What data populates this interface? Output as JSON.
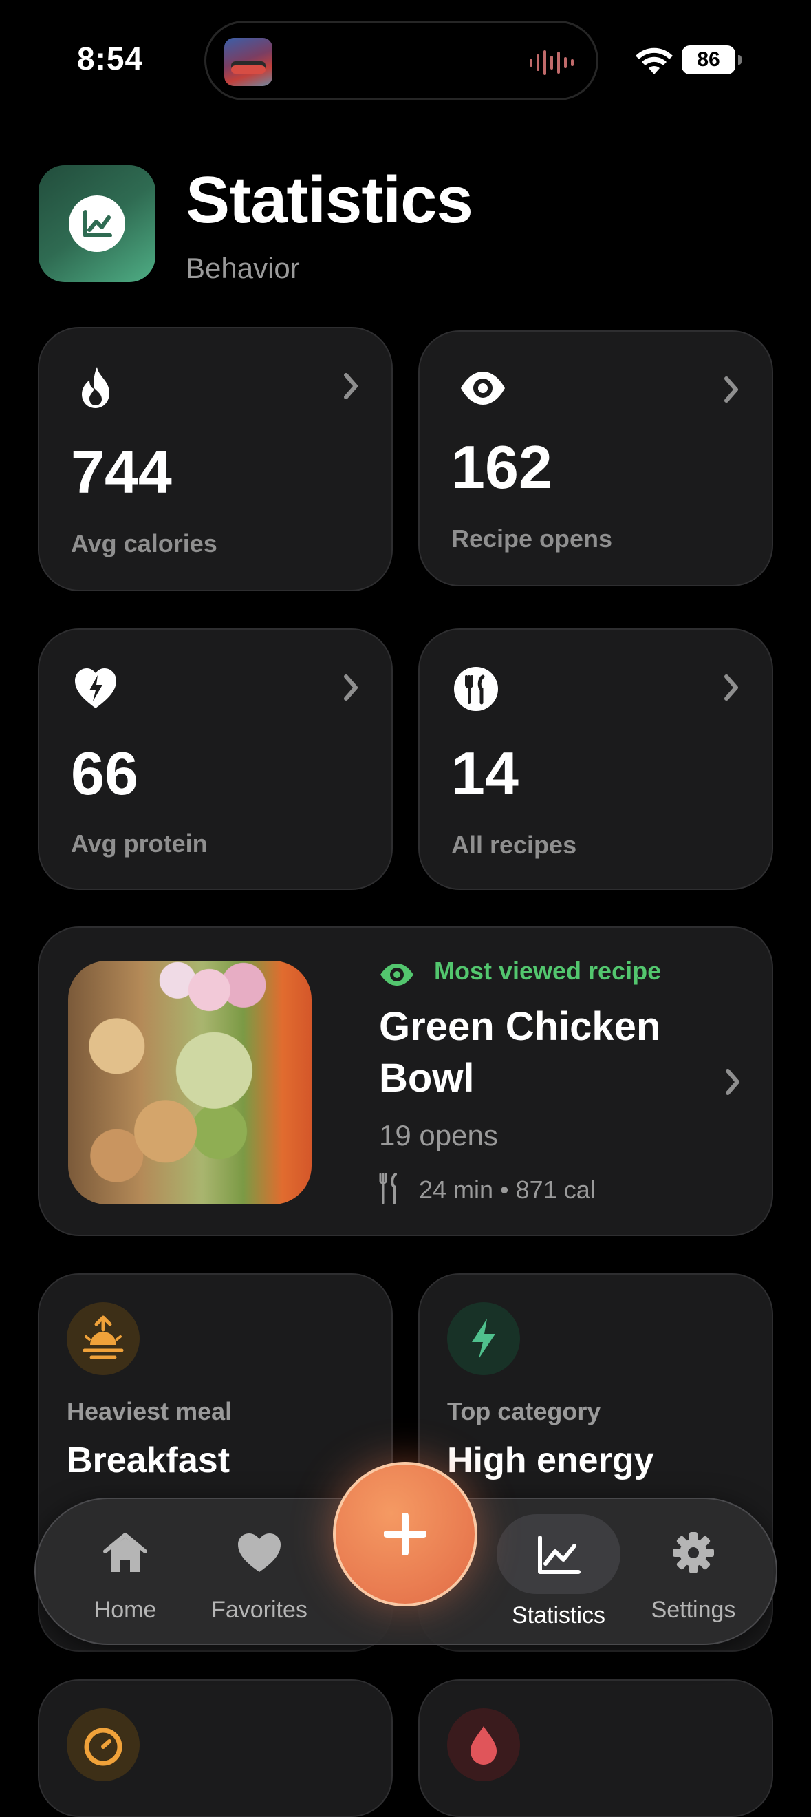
{
  "status_bar": {
    "time": "8:54",
    "battery": "86"
  },
  "header": {
    "title": "Statistics",
    "subtitle": "Behavior",
    "icon": "chart-icon"
  },
  "stats": [
    {
      "icon": "flame-icon",
      "value": "744",
      "label": "Avg calories"
    },
    {
      "icon": "eye-icon",
      "value": "162",
      "label": "Recipe opens"
    },
    {
      "icon": "heart-bolt-icon",
      "value": "66",
      "label": "Avg protein"
    },
    {
      "icon": "utensils-icon",
      "value": "14",
      "label": "All recipes"
    }
  ],
  "featured": {
    "badge": "Most viewed recipe",
    "title": "Green Chicken Bowl",
    "opens": "19 opens",
    "meta": "24 min • 871 cal"
  },
  "insights": [
    {
      "icon": "sunrise-icon",
      "label": "Heaviest meal",
      "value": "Breakfast",
      "color": "#f0a23a"
    },
    {
      "icon": "bolt-icon",
      "label": "Top category",
      "value": "High energy",
      "color": "#4fc08d"
    }
  ],
  "tabbar": {
    "items": [
      {
        "label": "Home",
        "icon": "home-icon"
      },
      {
        "label": "Favorites",
        "icon": "heart-icon"
      },
      {
        "label": "Statistics",
        "icon": "chart-icon",
        "active": true
      },
      {
        "label": "Settings",
        "icon": "gear-icon"
      }
    ],
    "add_icon": "plus-icon"
  },
  "colors": {
    "accent_green": "#53c66e",
    "fab_orange": "#ea7e52",
    "card_bg": "#1b1b1c"
  }
}
